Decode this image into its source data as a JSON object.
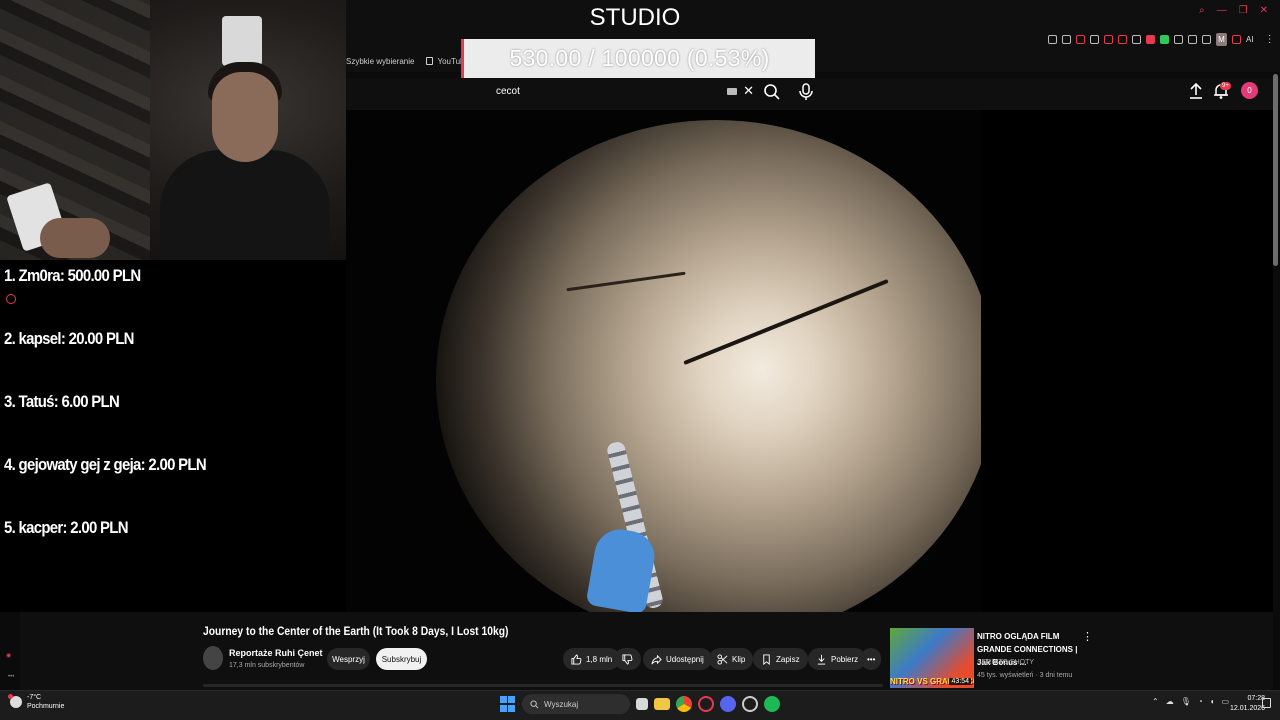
{
  "overlay": {
    "studio_title": "STUDIO",
    "goal_text": "530.00 / 100000 (0.53%)",
    "goal_progress_percent": 0.53,
    "donations": [
      "1. Zm0ra: 500.00 PLN",
      "2. kapsel: 20.00 PLN",
      "3. Tatuś: 6.00 PLN",
      "4. gejowaty gej z geja: 2.00 PLN",
      "5. kacper: 2.00 PLN"
    ]
  },
  "browser": {
    "bookmarks": [
      "Szybkie wybieranie",
      "YouTube"
    ],
    "extension_label": "AI",
    "extension_letter": "M"
  },
  "youtube": {
    "search_value": "cecot",
    "notifications_badge": "9+",
    "avatar_letter": "0",
    "video": {
      "title": "Journey to the Center of the Earth (It Took 8 Days, I Lost 10kg)",
      "channel_name": "Reportaże Ruhi Çenet",
      "channel_subs": "17,3 mln subskrybentów",
      "support_label": "Wesprzyj",
      "subscribe_label": "Subskrybuj",
      "likes": "1,8 mln",
      "share_label": "Udostępnij",
      "clip_label": "Klip",
      "save_label": "Zapisz",
      "download_label": "Pobierz"
    },
    "recommendation": {
      "thumb_text": "NITRO VS GRANDE CONNECTIONS",
      "duration": "43:54",
      "title": "NITRO OGLĄDA FILM GRANDE CONNECTIONS | Jak Bonus ...",
      "channel": "SERHITO SHOTY",
      "meta": "45 tys. wyświetleń · 3 dni temu"
    }
  },
  "taskbar": {
    "temperature": "-7°C",
    "weather_desc": "Pochmurnie",
    "search_placeholder": "Wyszukaj",
    "time": "07:28",
    "date": "12.01.2026"
  },
  "colors": {
    "accent": "#e63a4f",
    "youtube_bg": "#0f0f0f"
  }
}
